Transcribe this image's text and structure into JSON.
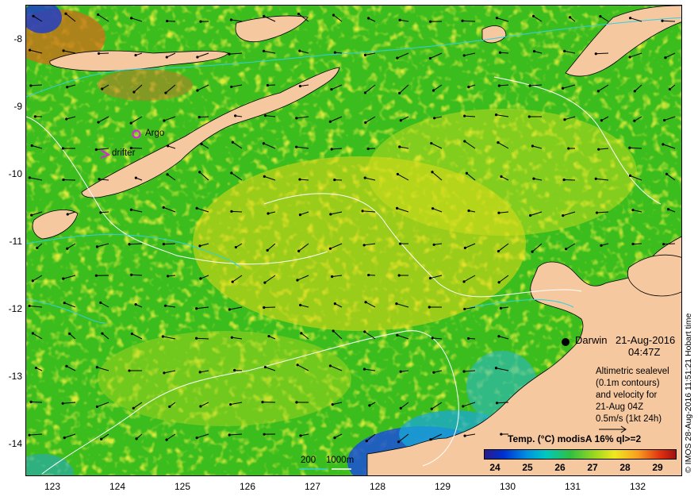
{
  "map": {
    "y_ticks": [
      "-8",
      "-9",
      "-10",
      "-11",
      "-12",
      "-13",
      "-14"
    ],
    "x_ticks": [
      "123",
      "124",
      "125",
      "126",
      "127",
      "128",
      "129",
      "130",
      "131",
      "132"
    ],
    "markers": {
      "argo": "Argo",
      "drifter": "drifter"
    },
    "city": {
      "name": "Darwin",
      "date": "21-Aug-2016",
      "time": "04:47Z"
    },
    "info": {
      "line1": "Altimetric sealevel",
      "line2": "(0.1m contours)",
      "line3": "and velocity for",
      "line4": "21-Aug 04Z",
      "line5": "0.5m/s (1kt 24h)"
    },
    "scale": {
      "left": "200",
      "right": "1000m"
    },
    "legend": {
      "title": "Temp. (°C) modisA 16% ql>=2",
      "ticks": [
        "24",
        "25",
        "26",
        "27",
        "28",
        "29"
      ],
      "colors": [
        "#2a1a8a",
        "#0030d0",
        "#0090e0",
        "#00c8c0",
        "#30c040",
        "#a0d820",
        "#f0e820",
        "#f8a020",
        "#e03010",
        "#a01010"
      ]
    },
    "credit": "© IMOS 28-Aug-2016 11:51:21 Hobart time",
    "colors": {
      "land": "#f6c8a0",
      "argo_marker": "#e020e0",
      "contour": "#ffffff",
      "isobath": "#30d0e0"
    }
  }
}
